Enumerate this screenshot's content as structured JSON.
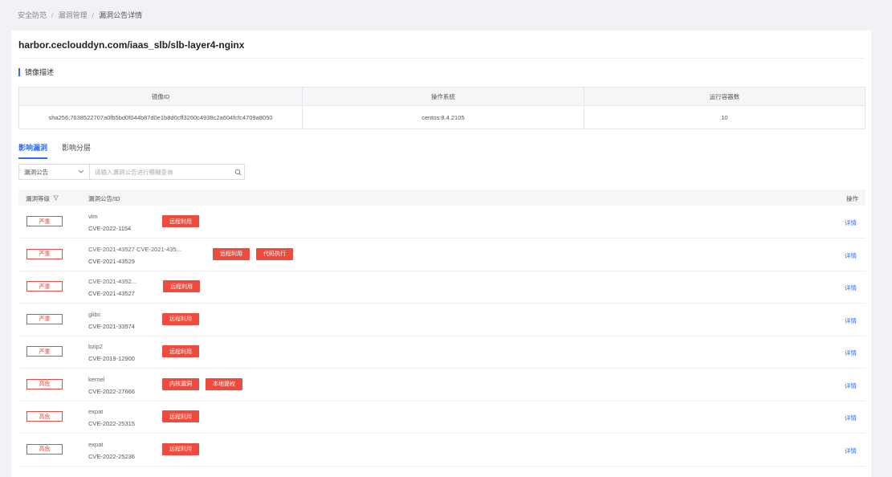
{
  "breadcrumb": {
    "items": [
      "安全防范",
      "漏洞管理",
      "漏洞公告详情"
    ],
    "separator": "/"
  },
  "image_title": "harbor.ceclouddyn.com/iaas_slb/slb-layer4-nginx",
  "section_title": "镜像描述",
  "desc_table": {
    "headers": [
      "镜像ID",
      "操作系统",
      "运行容器数"
    ],
    "row": [
      "sha256:7638522707a0fb5bd0f044b87d0e1b8d0cff3260c4938c2a604fcfc4709a8050",
      "centos:8.4.2105",
      "10"
    ]
  },
  "tabs": [
    {
      "label": "影响漏洞",
      "active": true
    },
    {
      "label": "影响分层",
      "active": false
    }
  ],
  "filter": {
    "select_value": "漏洞公告",
    "placeholder": "请输入漏洞公告进行模糊查询"
  },
  "list_header": {
    "level": "漏洞等级",
    "name": "漏洞公告/ID",
    "op": "操作"
  },
  "colors": {
    "accent": "#2d6df6",
    "danger": "#e8453c"
  },
  "rows": [
    {
      "level": "严重",
      "name": "vim",
      "id": "CVE-2022-1154",
      "tags": [
        "远程利用"
      ],
      "op": "详情"
    },
    {
      "level": "严重",
      "name": "CVE-2021-43527 CVE-2021-435...",
      "id": "CVE-2021-43529",
      "tags": [
        "远程利用",
        "代码执行"
      ],
      "op": "详情"
    },
    {
      "level": "严重",
      "name": "CVE-2021-4352...",
      "id": "CVE-2021-43527",
      "tags": [
        "远程利用"
      ],
      "op": "详情"
    },
    {
      "level": "严重",
      "name": "glibc",
      "id": "CVE-2021-33574",
      "tags": [
        "远程利用"
      ],
      "op": "详情"
    },
    {
      "level": "严重",
      "name": "bzip2",
      "id": "CVE-2019-12900",
      "tags": [
        "远程利用"
      ],
      "op": "详情"
    },
    {
      "level": "高危",
      "name": "kernel",
      "id": "CVE-2022-27666",
      "tags": [
        "内核漏洞",
        "本地提权"
      ],
      "op": "详情"
    },
    {
      "level": "高危",
      "name": "expat",
      "id": "CVE-2022-25315",
      "tags": [
        "远程利用"
      ],
      "op": "详情"
    },
    {
      "level": "高危",
      "name": "expat",
      "id": "CVE-2022-25236",
      "tags": [
        "远程利用"
      ],
      "op": "详情"
    }
  ]
}
